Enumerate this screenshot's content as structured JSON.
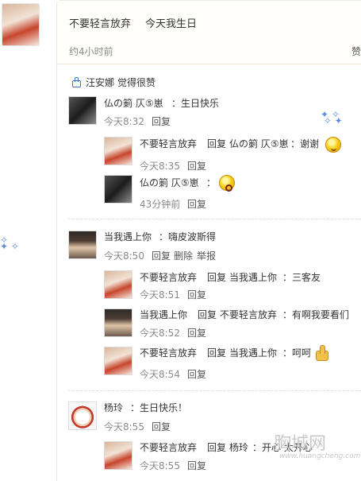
{
  "post": {
    "author": "不要轻言放弃",
    "text": "今天我生日",
    "time": "约4小时前",
    "like_label": "赞"
  },
  "likes": {
    "names": "汪安娜",
    "suffix": "觉得很赞"
  },
  "comments": [
    {
      "author": "仏の箣 仄⑤崽",
      "text": "：生日快乐",
      "time": "今天8:32",
      "actions": [
        "回复"
      ],
      "replies": [
        {
          "author": "不要轻言放弃",
          "reply_word": "回复",
          "target": "仏の箣 仄⑤崽",
          "text": "：谢谢",
          "time": "今天8:35",
          "actions": [
            "回复"
          ]
        },
        {
          "author": "仏の箣 仄⑤崽",
          "text": "：",
          "time": "43分钟前",
          "actions": [
            "回复"
          ]
        }
      ]
    },
    {
      "author": "当我遇上你",
      "text": "：嗨皮波斯得",
      "time": "今天8:50",
      "actions": [
        "回复",
        "删除",
        "举报"
      ],
      "replies": [
        {
          "author": "不要轻言放弃",
          "reply_word": "回复",
          "target": "当我遇上你",
          "text": "：三客友",
          "time": "今天8:51",
          "actions": [
            "回复"
          ]
        },
        {
          "author": "当我遇上你",
          "reply_word": "回复",
          "target": "不要轻言放弃",
          "text": "：有啊我要看们",
          "time": "今天8:52",
          "actions": [
            "回复"
          ]
        },
        {
          "author": "不要轻言放弃",
          "reply_word": "回复",
          "target": "当我遇上你",
          "text": "：呵呵",
          "time": "今天8:54",
          "actions": [
            "回复"
          ]
        }
      ]
    },
    {
      "author": "杨玲",
      "text": "：生日快乐！",
      "time": "今天8:55",
      "actions": [
        "回复"
      ],
      "replies": [
        {
          "author": "不要轻言放弃",
          "reply_word": "回复",
          "target": "杨玲",
          "text": "：开心 太开心",
          "time": "今天8:55",
          "actions": [
            "回复"
          ]
        }
      ]
    }
  ],
  "watermark": {
    "brand": "胸城网",
    "url": "www.huangcheng.com"
  },
  "icons": [
    "like-thumb-icon",
    "smile-emoji-icon",
    "shock-emoji-icon",
    "thumbs-up-emoji-icon",
    "sparkle-decoration-icon"
  ]
}
